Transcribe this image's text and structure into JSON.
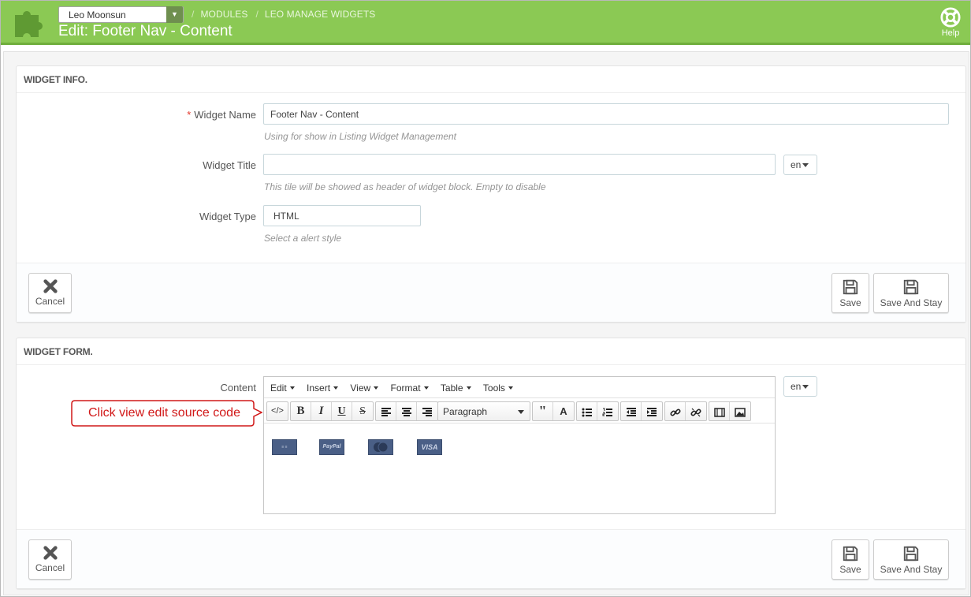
{
  "header": {
    "shop_select": "Leo Moonsun",
    "breadcrumb": [
      "MODULES",
      "LEO MANAGE WIDGETS"
    ],
    "title": "Edit: Footer Nav - Content",
    "help_label": "Help",
    "accent_color": "#8bc954"
  },
  "widget_info": {
    "heading": "WIDGET INFO.",
    "name_label": "Widget Name",
    "name_required_mark": "*",
    "name_value": "Footer Nav - Content",
    "name_help": "Using for show in Listing Widget Management",
    "title_label": "Widget Title",
    "title_value": "",
    "title_lang": "en",
    "title_help": "This tile will be showed as header of widget block. Empty to disable",
    "type_label": "Widget Type",
    "type_value": "HTML",
    "type_help": "Select a alert style"
  },
  "widget_form": {
    "heading": "WIDGET FORM.",
    "content_label": "Content",
    "content_lang": "en",
    "menu": [
      "Edit",
      "Insert",
      "View",
      "Format",
      "Table",
      "Tools"
    ],
    "format_select": "Paragraph",
    "toolbar_icons": [
      "source-code-icon",
      "bold-icon",
      "italic-icon",
      "underline-icon",
      "strikethrough-icon",
      "align-left-icon",
      "align-center-icon",
      "align-right-icon",
      "blockquote-icon",
      "text-color-icon",
      "bullet-list-icon",
      "numbered-list-icon",
      "outdent-icon",
      "indent-icon",
      "link-icon",
      "unlink-icon",
      "media-icon",
      "image-icon"
    ],
    "payment_icons": [
      "western-union-icon",
      "paypal-icon",
      "mastercard-icon",
      "visa-icon"
    ],
    "paypal_text": "PayPal",
    "visa_text": "VISA"
  },
  "buttons": {
    "cancel": "Cancel",
    "save": "Save",
    "save_and_stay": "Save And Stay"
  },
  "callout": {
    "text": "Click view edit source code",
    "color": "#d11818"
  }
}
